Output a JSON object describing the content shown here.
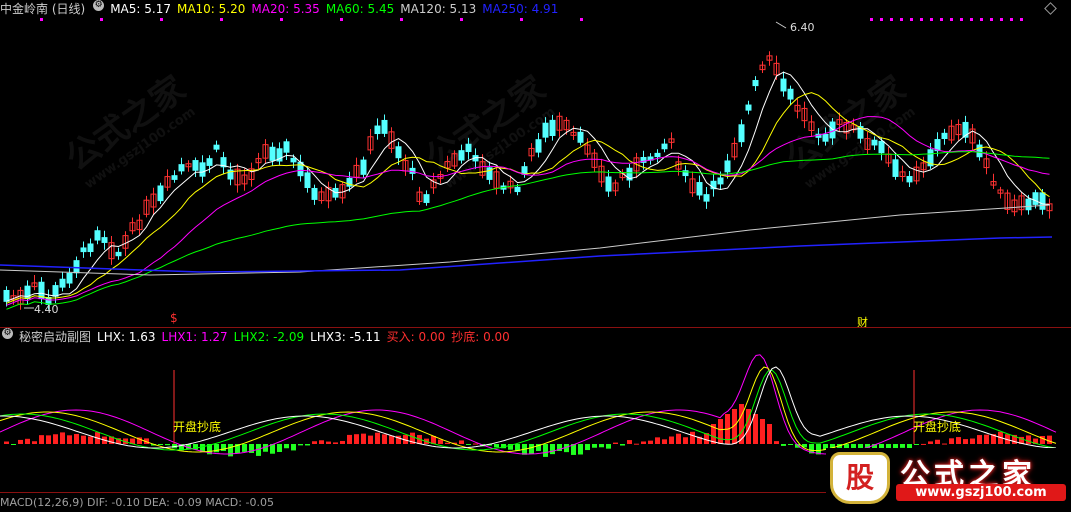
{
  "main_header": {
    "stock": "中金岭南 (日线)",
    "ma": [
      {
        "label": "MA5: 5.17",
        "color": "#ffffff"
      },
      {
        "label": "MA10: 5.20",
        "color": "#ffff00"
      },
      {
        "label": "MA20: 5.35",
        "color": "#ff00ff"
      },
      {
        "label": "MA60: 5.45",
        "color": "#00ff00"
      },
      {
        "label": "MA120: 5.13",
        "color": "#cccccc"
      },
      {
        "label": "MA250: 4.91",
        "color": "#2222ff"
      }
    ]
  },
  "sub_header": {
    "name": "秘密启动副图",
    "items": [
      {
        "label": "LHX: 1.63",
        "color": "#ffffff"
      },
      {
        "label": "LHX1: 1.27",
        "color": "#ff00ff"
      },
      {
        "label": "LHX2: -2.09",
        "color": "#00ff00"
      },
      {
        "label": "LHX3: -5.11",
        "color": "#ffffff"
      },
      {
        "label": "买入: 0.00",
        "color": "#ff3030"
      },
      {
        "label": "抄底: 0.00",
        "color": "#ff3030"
      }
    ]
  },
  "bottom_header": "MACD(12,26,9) DIF: -0.10 DEA: -0.09 MACD: -0.05",
  "annotations": {
    "high": "6.40",
    "low": "4.40",
    "marker_s": "$",
    "marker_cai": "财",
    "signal_1": "开盘抄底",
    "signal_2": "开盘抄底"
  },
  "watermark": {
    "text": "公式之家",
    "url": "www.gszj100.com"
  },
  "logo": {
    "glyph": "股",
    "name": "公式之家",
    "url": "www.gszj100.com"
  },
  "colors": {
    "up": "#ff3232",
    "down": "#54ffff",
    "divider": "#8a1010"
  }
}
